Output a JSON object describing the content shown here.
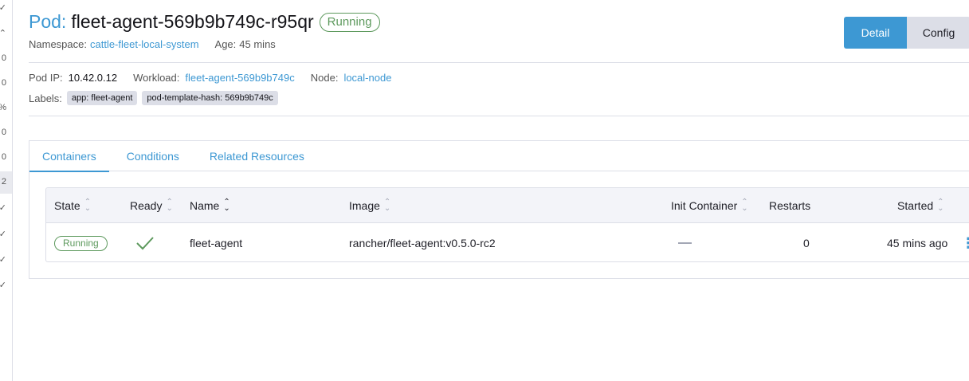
{
  "sidebar": {
    "glyphs": [
      "✓",
      "⌃",
      "0",
      "0",
      "%",
      "0",
      "0",
      "2",
      "✓",
      "✓",
      "✓",
      "✓"
    ]
  },
  "header": {
    "resource_type": "Pod:",
    "resource_name": "fleet-agent-569b9b749c-r95qr",
    "state": "Running",
    "namespace_label": "Namespace:",
    "namespace_value": "cattle-fleet-local-system",
    "age_label": "Age:",
    "age_value": "45 mins"
  },
  "view_toggle": {
    "detail_label": "Detail",
    "config_label": "Config",
    "selected": "Detail"
  },
  "info": {
    "pod_ip_label": "Pod IP:",
    "pod_ip_value": "10.42.0.12",
    "workload_label": "Workload:",
    "workload_value": "fleet-agent-569b9b749c",
    "node_label": "Node:",
    "node_value": "local-node",
    "labels_label": "Labels:",
    "labels": [
      "app: fleet-agent",
      "pod-template-hash: 569b9b749c"
    ]
  },
  "tabs": [
    {
      "label": "Containers",
      "active": true
    },
    {
      "label": "Conditions",
      "active": false
    },
    {
      "label": "Related Resources",
      "active": false
    }
  ],
  "table": {
    "columns": [
      "State",
      "Ready",
      "Name",
      "Image",
      "Init Container",
      "Restarts",
      "Started"
    ],
    "rows": [
      {
        "state": "Running",
        "ready": true,
        "name": "fleet-agent",
        "image": "rancher/fleet-agent:v0.5.0-rc2",
        "init_container": "—",
        "restarts": "0",
        "started": "45 mins ago"
      }
    ]
  },
  "colors": {
    "accent": "#3d98d3",
    "success": "#5d995d",
    "border": "#dcdee7",
    "header_bg": "#f3f4f9"
  }
}
